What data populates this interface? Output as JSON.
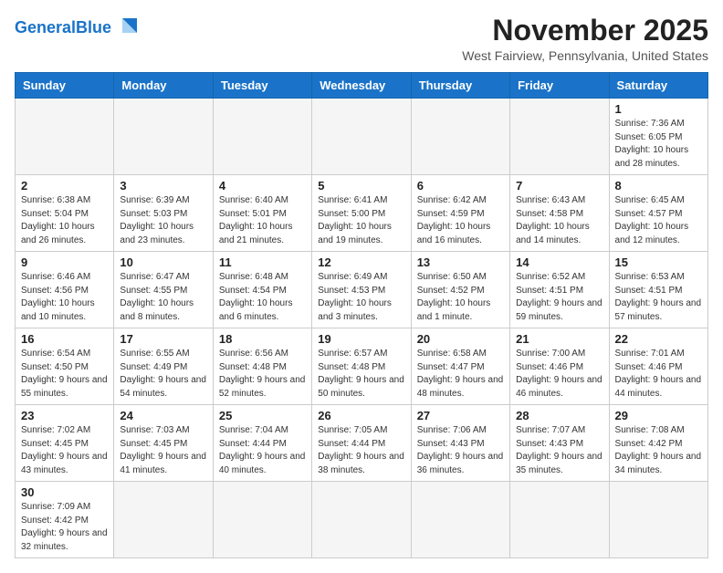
{
  "header": {
    "logo_general": "General",
    "logo_blue": "Blue",
    "month_title": "November 2025",
    "location": "West Fairview, Pennsylvania, United States"
  },
  "weekdays": [
    "Sunday",
    "Monday",
    "Tuesday",
    "Wednesday",
    "Thursday",
    "Friday",
    "Saturday"
  ],
  "weeks": [
    [
      {
        "day": "",
        "info": ""
      },
      {
        "day": "",
        "info": ""
      },
      {
        "day": "",
        "info": ""
      },
      {
        "day": "",
        "info": ""
      },
      {
        "day": "",
        "info": ""
      },
      {
        "day": "",
        "info": ""
      },
      {
        "day": "1",
        "info": "Sunrise: 7:36 AM\nSunset: 6:05 PM\nDaylight: 10 hours and 28 minutes."
      }
    ],
    [
      {
        "day": "2",
        "info": "Sunrise: 6:38 AM\nSunset: 5:04 PM\nDaylight: 10 hours and 26 minutes."
      },
      {
        "day": "3",
        "info": "Sunrise: 6:39 AM\nSunset: 5:03 PM\nDaylight: 10 hours and 23 minutes."
      },
      {
        "day": "4",
        "info": "Sunrise: 6:40 AM\nSunset: 5:01 PM\nDaylight: 10 hours and 21 minutes."
      },
      {
        "day": "5",
        "info": "Sunrise: 6:41 AM\nSunset: 5:00 PM\nDaylight: 10 hours and 19 minutes."
      },
      {
        "day": "6",
        "info": "Sunrise: 6:42 AM\nSunset: 4:59 PM\nDaylight: 10 hours and 16 minutes."
      },
      {
        "day": "7",
        "info": "Sunrise: 6:43 AM\nSunset: 4:58 PM\nDaylight: 10 hours and 14 minutes."
      },
      {
        "day": "8",
        "info": "Sunrise: 6:45 AM\nSunset: 4:57 PM\nDaylight: 10 hours and 12 minutes."
      }
    ],
    [
      {
        "day": "9",
        "info": "Sunrise: 6:46 AM\nSunset: 4:56 PM\nDaylight: 10 hours and 10 minutes."
      },
      {
        "day": "10",
        "info": "Sunrise: 6:47 AM\nSunset: 4:55 PM\nDaylight: 10 hours and 8 minutes."
      },
      {
        "day": "11",
        "info": "Sunrise: 6:48 AM\nSunset: 4:54 PM\nDaylight: 10 hours and 6 minutes."
      },
      {
        "day": "12",
        "info": "Sunrise: 6:49 AM\nSunset: 4:53 PM\nDaylight: 10 hours and 3 minutes."
      },
      {
        "day": "13",
        "info": "Sunrise: 6:50 AM\nSunset: 4:52 PM\nDaylight: 10 hours and 1 minute."
      },
      {
        "day": "14",
        "info": "Sunrise: 6:52 AM\nSunset: 4:51 PM\nDaylight: 9 hours and 59 minutes."
      },
      {
        "day": "15",
        "info": "Sunrise: 6:53 AM\nSunset: 4:51 PM\nDaylight: 9 hours and 57 minutes."
      }
    ],
    [
      {
        "day": "16",
        "info": "Sunrise: 6:54 AM\nSunset: 4:50 PM\nDaylight: 9 hours and 55 minutes."
      },
      {
        "day": "17",
        "info": "Sunrise: 6:55 AM\nSunset: 4:49 PM\nDaylight: 9 hours and 54 minutes."
      },
      {
        "day": "18",
        "info": "Sunrise: 6:56 AM\nSunset: 4:48 PM\nDaylight: 9 hours and 52 minutes."
      },
      {
        "day": "19",
        "info": "Sunrise: 6:57 AM\nSunset: 4:48 PM\nDaylight: 9 hours and 50 minutes."
      },
      {
        "day": "20",
        "info": "Sunrise: 6:58 AM\nSunset: 4:47 PM\nDaylight: 9 hours and 48 minutes."
      },
      {
        "day": "21",
        "info": "Sunrise: 7:00 AM\nSunset: 4:46 PM\nDaylight: 9 hours and 46 minutes."
      },
      {
        "day": "22",
        "info": "Sunrise: 7:01 AM\nSunset: 4:46 PM\nDaylight: 9 hours and 44 minutes."
      }
    ],
    [
      {
        "day": "23",
        "info": "Sunrise: 7:02 AM\nSunset: 4:45 PM\nDaylight: 9 hours and 43 minutes."
      },
      {
        "day": "24",
        "info": "Sunrise: 7:03 AM\nSunset: 4:45 PM\nDaylight: 9 hours and 41 minutes."
      },
      {
        "day": "25",
        "info": "Sunrise: 7:04 AM\nSunset: 4:44 PM\nDaylight: 9 hours and 40 minutes."
      },
      {
        "day": "26",
        "info": "Sunrise: 7:05 AM\nSunset: 4:44 PM\nDaylight: 9 hours and 38 minutes."
      },
      {
        "day": "27",
        "info": "Sunrise: 7:06 AM\nSunset: 4:43 PM\nDaylight: 9 hours and 36 minutes."
      },
      {
        "day": "28",
        "info": "Sunrise: 7:07 AM\nSunset: 4:43 PM\nDaylight: 9 hours and 35 minutes."
      },
      {
        "day": "29",
        "info": "Sunrise: 7:08 AM\nSunset: 4:42 PM\nDaylight: 9 hours and 34 minutes."
      }
    ],
    [
      {
        "day": "30",
        "info": "Sunrise: 7:09 AM\nSunset: 4:42 PM\nDaylight: 9 hours and 32 minutes."
      },
      {
        "day": "",
        "info": ""
      },
      {
        "day": "",
        "info": ""
      },
      {
        "day": "",
        "info": ""
      },
      {
        "day": "",
        "info": ""
      },
      {
        "day": "",
        "info": ""
      },
      {
        "day": "",
        "info": ""
      }
    ]
  ]
}
